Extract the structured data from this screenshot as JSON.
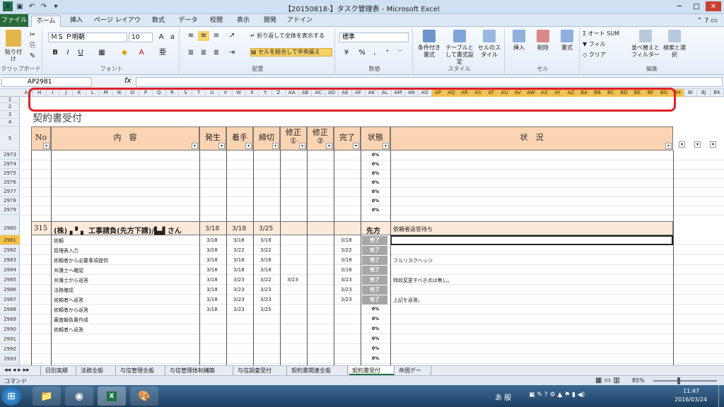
{
  "window": {
    "title": "【20150818-】タスク管理表 - Microsoft Excel"
  },
  "ribbon_tabs": [
    "ファイル",
    "ホーム",
    "挿入",
    "ページ レイアウト",
    "数式",
    "データ",
    "校閲",
    "表示",
    "開発",
    "アドイン"
  ],
  "ribbon": {
    "paste": "貼り付け",
    "clipboard": "クリップボード",
    "font_name": "ＭＳ Ｐ明朝",
    "font_size": "10",
    "font_group": "フォント",
    "wrap": "折り返して全体を表示する",
    "merge": "セルを結合して中央揃え",
    "align_group": "配置",
    "number_format": "標準",
    "number_group": "数値",
    "cond_format": "条件付き書式",
    "table_format": "テーブルとして書式設定",
    "cell_style": "セルのスタイル",
    "style_group": "スタイル",
    "insert": "挿入",
    "delete": "削除",
    "format": "書式",
    "cell_group": "セル",
    "autosum": "オート SUM",
    "fill": "フィル",
    "clear": "クリア",
    "sort": "並べ替えとフィルター",
    "find": "検索と選択",
    "edit_group": "編集"
  },
  "namebox": "AP2981",
  "fx": "fx",
  "columns": [
    "A",
    "H",
    "I",
    "J",
    "K",
    "L",
    "M",
    "N",
    "O",
    "P",
    "Q",
    "R",
    "S",
    "T",
    "U",
    "V",
    "W",
    "X",
    "Y",
    "Z",
    "AA",
    "AB",
    "AC",
    "AD",
    "AE",
    "AF",
    "AK",
    "AL",
    "AM",
    "AN",
    "AO",
    "AP",
    "AQ",
    "AR",
    "AS",
    "AT",
    "AU",
    "AV",
    "AW",
    "AX",
    "AY",
    "AZ",
    "BA",
    "BB",
    "BC",
    "BD",
    "BE",
    "BF",
    "BG",
    "BH",
    "BI",
    "BJ",
    "BK"
  ],
  "sheet_title": "契約書受付",
  "headers": {
    "no": "No",
    "content": "内　容",
    "occur": "発生",
    "start": "着手",
    "deadline": "締切",
    "fix1": "修正\n①",
    "fix2": "修正\n②",
    "done": "完了",
    "state": "状態",
    "status": "状　況"
  },
  "rows": [
    {
      "n": "1",
      "pct": "0%"
    },
    {
      "n": "2",
      "pct": ""
    },
    {
      "n": "3",
      "pct": ""
    },
    {
      "n": "4",
      "pct": "0%"
    },
    {
      "n": "5",
      "pct": "0%"
    },
    {
      "n": "2973",
      "pct": "0%"
    },
    {
      "n": "2974",
      "pct": "0%"
    },
    {
      "n": "2975",
      "pct": "0%"
    },
    {
      "n": "2976",
      "pct": "0%"
    },
    {
      "n": "2977",
      "pct": "0%"
    },
    {
      "n": "2978",
      "pct": "0%"
    },
    {
      "n": "2979",
      "pct": "0%"
    }
  ],
  "main_row": {
    "n": "2980",
    "no": "315",
    "content": "(株) ▖▘▖ 工事請負(先方下請)/▙▟ さん",
    "occur": "3/18",
    "start": "3/18",
    "deadline": "3/25",
    "state": "先方",
    "status": "依頼者返答待ち"
  },
  "sub_rows": [
    {
      "n": "2981",
      "task": "依頼",
      "occur": "3/18",
      "start": "3/18",
      "deadline": "3/18",
      "fix1": "",
      "done": "3/18",
      "state": "完了",
      "status": ""
    },
    {
      "n": "2982",
      "task": "管理表入力",
      "occur": "3/18",
      "start": "3/22",
      "deadline": "3/22",
      "fix1": "",
      "done": "3/22",
      "state": "完了",
      "status": ""
    },
    {
      "n": "2983",
      "task": "依頼者から必要事項提供",
      "occur": "3/18",
      "start": "3/18",
      "deadline": "3/18",
      "fix1": "",
      "done": "3/18",
      "state": "完了",
      "status": "フルリスクヘッジ"
    },
    {
      "n": "2984",
      "task": "弁護士へ確認",
      "occur": "3/18",
      "start": "3/18",
      "deadline": "3/18",
      "fix1": "",
      "done": "3/18",
      "state": "完了",
      "status": ""
    },
    {
      "n": "2985",
      "task": "弁護士から返答",
      "occur": "3/18",
      "start": "3/23",
      "deadline": "3/22",
      "fix1": "3/23",
      "done": "3/23",
      "state": "完了",
      "status": "特段変更すべき点は無し。"
    },
    {
      "n": "2986",
      "task": "法務確認",
      "occur": "3/18",
      "start": "3/23",
      "deadline": "3/23",
      "fix1": "",
      "done": "3/23",
      "state": "完了",
      "status": ""
    },
    {
      "n": "2987",
      "task": "依頼者へ返答",
      "occur": "3/18",
      "start": "3/23",
      "deadline": "3/23",
      "fix1": "",
      "done": "3/23",
      "state": "完了",
      "status": "上記を返答。"
    },
    {
      "n": "2988",
      "task": "依頼者から返答",
      "occur": "3/18",
      "start": "3/23",
      "deadline": "3/25",
      "fix1": "",
      "done": "",
      "state": "0%",
      "status": ""
    },
    {
      "n": "2989",
      "task": "審査報告書作成",
      "occur": "",
      "start": "",
      "deadline": "",
      "fix1": "",
      "done": "",
      "state": "0%",
      "status": ""
    },
    {
      "n": "2990",
      "task": "依頼者へ返答",
      "occur": "",
      "start": "",
      "deadline": "",
      "fix1": "",
      "done": "",
      "state": "0%",
      "status": ""
    },
    {
      "n": "2991",
      "task": "",
      "occur": "",
      "start": "",
      "deadline": "",
      "fix1": "",
      "done": "",
      "state": "0%",
      "status": ""
    },
    {
      "n": "2992",
      "task": "",
      "occur": "",
      "start": "",
      "deadline": "",
      "fix1": "",
      "done": "",
      "state": "0%",
      "status": ""
    },
    {
      "n": "2993",
      "task": "",
      "occur": "",
      "start": "",
      "deadline": "",
      "fix1": "",
      "done": "",
      "state": "0%",
      "status": ""
    }
  ],
  "sheet_tabs": [
    "日別実績",
    "法務全般",
    "与信管理全般",
    "与信管理体制構築",
    "与信調査受付",
    "契約書関連全般",
    "契約書受付",
    "帝国デー"
  ],
  "status": {
    "mode": "コマンド",
    "zoom": "85%"
  },
  "taskbar": {
    "time": "11:47",
    "date": "2016/03/24",
    "ime": "あ 般"
  }
}
